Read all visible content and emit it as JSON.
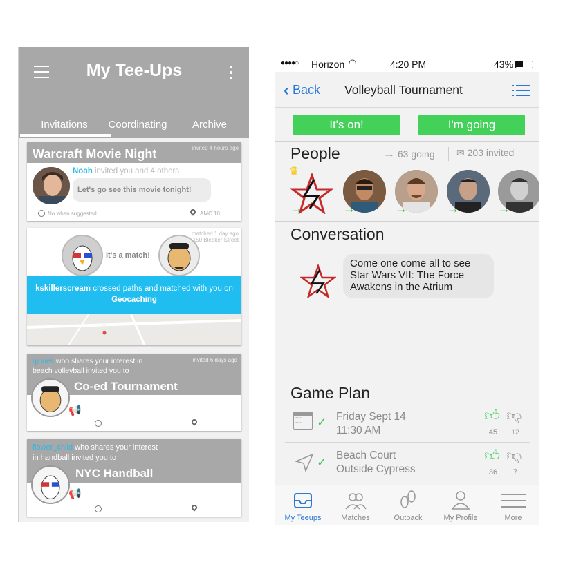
{
  "left": {
    "header": {
      "title": "My Tee-Ups"
    },
    "tabs": [
      "Invitations",
      "Coordinating",
      "Archive"
    ],
    "cards": {
      "warcraft": {
        "title": "Warcraft Movie Night",
        "time": "invited 4 hours ago",
        "inviter": "Noah",
        "invite_text": "invited you and 4 others",
        "message": "Let's go see this movie tonight!",
        "when": "No when suggested",
        "where": "AMC 10"
      },
      "match": {
        "time": "matched 1 day ago",
        "location": "at 150 Bleeker Street",
        "match_text": "It's a match!",
        "user": "kskillerscream",
        "middle": "crossed paths and matched with you on",
        "app": "Geocaching"
      },
      "coed": {
        "user": "qjones",
        "text1": "who shares your interest in",
        "text2": "beach volleyball invited you to",
        "time": "invited 6 days ago",
        "title": "Co-ed Tournament"
      },
      "nyc": {
        "user": "flower_child",
        "text1": "who shares your interest",
        "text2": "in handball invited you to",
        "title": "NYC Handball"
      }
    }
  },
  "right": {
    "status": {
      "carrier": "Horizon",
      "time": "4:20 PM",
      "battery": "43%"
    },
    "nav": {
      "back": "Back",
      "title": "Volleyball Tournament"
    },
    "buttons": {
      "its_on": "It's on!",
      "im_going": "I'm going"
    },
    "people": {
      "title": "People",
      "going": "63 going",
      "invited": "203 invited"
    },
    "conversation": {
      "title": "Conversation",
      "line1": "Come one come all to see",
      "line2": "Star Wars VII: The Force",
      "line3": "Awakens in the Atrium"
    },
    "game_plan": {
      "title": "Game Plan",
      "date_line1": "Friday Sept 14",
      "date_line2": "11:30 AM",
      "date_up": "45",
      "date_down": "12",
      "place_line1": "Beach Court",
      "place_line2": "Outside Cypress",
      "place_up": "36",
      "place_down": "7"
    },
    "tabbar": [
      "My Teeups",
      "Matches",
      "Outback",
      "My Profile",
      "More"
    ],
    "colors": {
      "accent": "#2a7ad5",
      "green": "#43d15a",
      "match_blue": "#1fbdf0"
    }
  }
}
